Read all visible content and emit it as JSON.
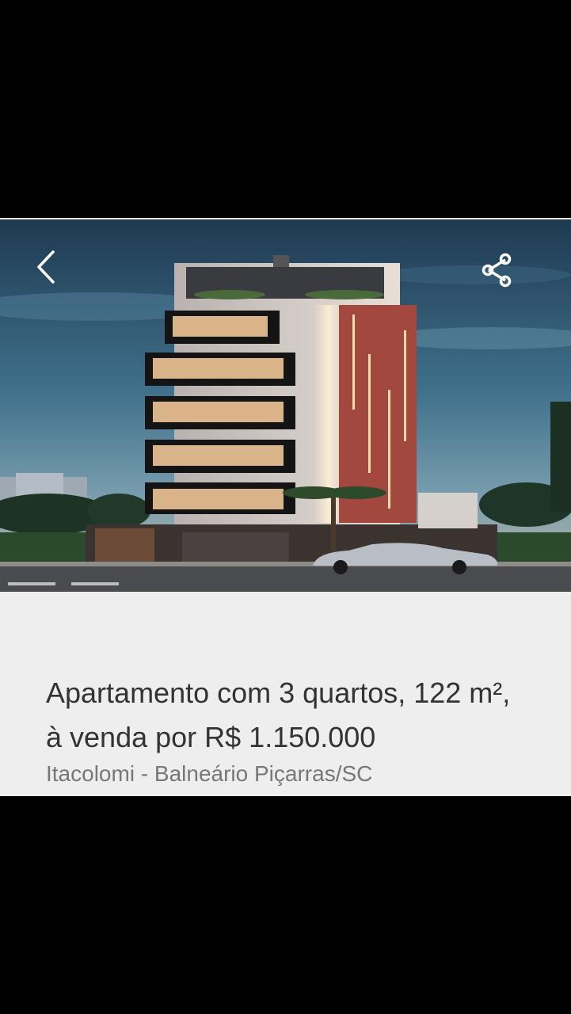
{
  "listing": {
    "title": "Apartamento com 3 quartos, 122 m², à venda por R$ 1.150.000",
    "location": "Itacolomi - Balneário Piçarras/SC"
  },
  "header": {
    "back_icon": "chevron-left-icon",
    "share_icon": "share-icon"
  },
  "colors": {
    "background": "#000000",
    "info_panel": "#eeeeee",
    "title_text": "#333333",
    "location_text": "#777777"
  }
}
